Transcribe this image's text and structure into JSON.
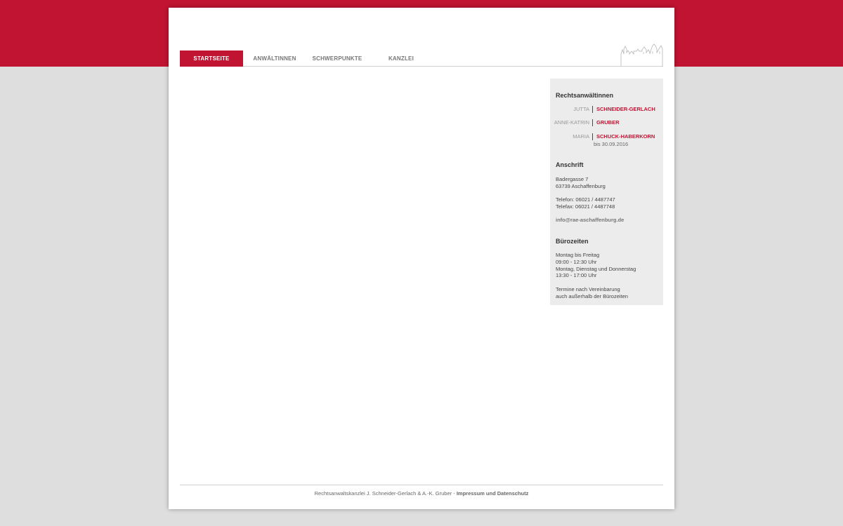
{
  "nav": {
    "items": [
      {
        "label": "STARTSEITE",
        "active": true
      },
      {
        "label": "ANWÄLTINNEN",
        "active": false
      },
      {
        "label": "SCHWERPUNKTE",
        "active": false
      },
      {
        "label": "KANZLEI",
        "active": false
      }
    ]
  },
  "sidebar": {
    "lawyers_heading": "Rechtsanwältinnen",
    "lawyers": [
      {
        "first": "JUTTA",
        "last": "SCHNEIDER-GERLACH",
        "note": ""
      },
      {
        "first": "ANNE-KATRIN",
        "last": "GRUBER",
        "note": ""
      },
      {
        "first": "MARIA",
        "last": "SCHUCK-HABERKORN",
        "note": "bis 30.09.2016"
      }
    ],
    "address_heading": "Anschrift",
    "street": "Badergasse 7",
    "city": "63739 Aschaffenburg",
    "phone": "Telefon: 06021 / 4487747",
    "fax": "Telefax: 06021 / 4487748",
    "email": "info@rae-aschaffenburg.de",
    "hours_heading": "Bürozeiten",
    "hours": [
      "Montag bis Freitag",
      "09:00 - 12:30 Uhr",
      "Montag, Dienstag und Donnerstag",
      "13:30 - 17:00 Uhr"
    ],
    "appointment": [
      "Termine nach Vereinbarung",
      "auch außerhalb der Bürozeiten"
    ]
  },
  "footer": {
    "text": "Rechtsanwaltskanzlei J. Schneider-Gerlach & A.-K. Gruber - ",
    "link": "Impressum und Datenschutz"
  },
  "colors": {
    "brand": "#c01432",
    "background": "#dedede",
    "sidebar": "#ececec"
  },
  "icons": {
    "logo": "castle-outline-icon"
  }
}
